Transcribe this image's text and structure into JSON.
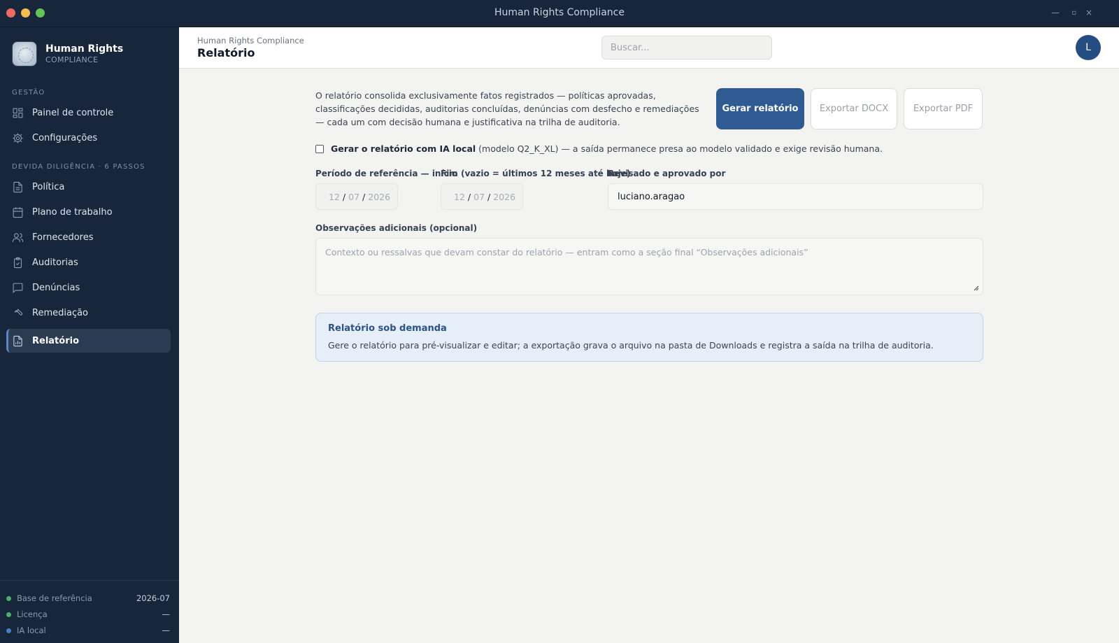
{
  "window": {
    "title": "Human Rights Compliance",
    "controls": {
      "minimize": "—",
      "maximize": "▫",
      "close": "×"
    }
  },
  "brand": {
    "name": "Human Rights",
    "sub": "COMPLIANCE"
  },
  "sidebar": {
    "section_gestao": "GESTÃO",
    "gestao_items": [
      {
        "label": "Painel de controle",
        "icon": "dashboard-icon"
      },
      {
        "label": "Configurações",
        "icon": "gear-icon"
      }
    ],
    "section_devida": "DEVIDA DILIGÊNCIA · 6 PASSOS",
    "devida_items": [
      {
        "label": "Política",
        "icon": "document-icon"
      },
      {
        "label": "Plano de trabalho",
        "icon": "calendar-icon"
      },
      {
        "label": "Fornecedores",
        "icon": "users-icon"
      },
      {
        "label": "Auditorias",
        "icon": "clipboard-check-icon"
      },
      {
        "label": "Denúncias",
        "icon": "message-icon"
      },
      {
        "label": "Remediação",
        "icon": "wrench-icon"
      },
      {
        "label": "Relatório",
        "icon": "report-chart-icon",
        "active": true
      }
    ],
    "footer": [
      {
        "label": "Base de referência",
        "value": "2026-07",
        "dot_color": "#4caf6e"
      },
      {
        "label": "Licença",
        "value": "—",
        "dot_color": "#4caf6e"
      },
      {
        "label": "IA local",
        "value": "—",
        "dot_color": "#4a7fc1"
      }
    ]
  },
  "header": {
    "breadcrumb": "Human Rights Compliance",
    "title": "Relatório",
    "search_placeholder": "Buscar...",
    "avatar_initial": "L"
  },
  "report": {
    "intro": "O relatório consolida exclusivamente fatos registrados — políticas aprovadas, classificações decididas, auditorias concluídas, denúncias com desfecho e remediações — cada um com decisão humana e justificativa na trilha de auditoria.",
    "buttons": {
      "generate": "Gerar relatório",
      "export_docx": "Exportar DOCX",
      "export_pdf": "Exportar PDF"
    },
    "ai_checkbox": {
      "bold": "Gerar o relatório com IA local",
      "rest": "(modelo Q2_K_XL) — a saída permanece presa ao modelo validado e exige revisão humana.",
      "checked": false
    },
    "start_label": "Período de referência — início",
    "end_label": "Fim (vazio = últimos 12 meses até hoje)",
    "approver_label": "Revisado e aprovado por",
    "start_date": {
      "day": "12",
      "month": "07",
      "year": "2026"
    },
    "end_date": {
      "day": "12",
      "month": "07",
      "year": "2026"
    },
    "approver_value": "luciano.aragao",
    "observations_label": "Observações adicionais (opcional)",
    "observations_placeholder": "Contexto ou ressalvas que devam constar do relatório — entram como a seção final “Observações adicionais”",
    "info_title": "Relatório sob demanda",
    "info_body": "Gere o relatório para pré-visualizar e editar; a exportação grava o arquivo na pasta de Downloads e registra a saída na trilha de auditoria."
  },
  "colors": {
    "sidebar_bg": "#17263a",
    "accent": "#2f5a92",
    "avatar": "#254d82"
  }
}
